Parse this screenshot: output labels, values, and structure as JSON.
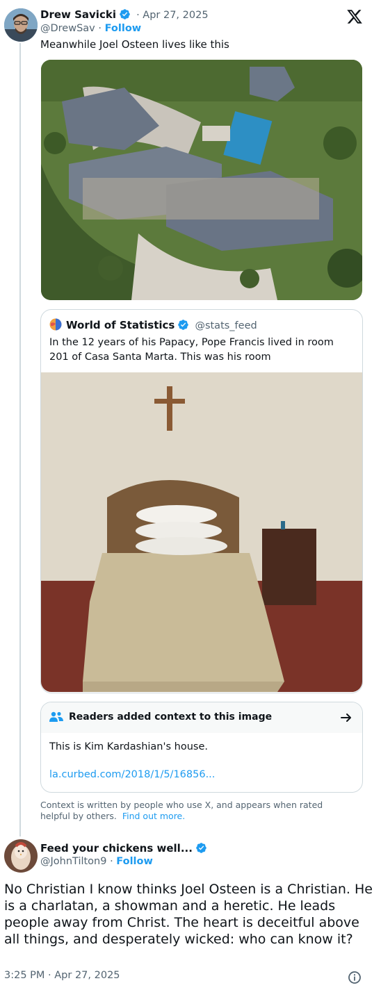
{
  "tweet": {
    "author_name": "Drew Savicki",
    "handle": "@DrewSav",
    "separator": "·",
    "date": "Apr 27, 2025",
    "follow_label": "Follow",
    "text": "Meanwhile Joel Osteen lives like this"
  },
  "quote": {
    "author_name": "World of Statistics",
    "handle": "@stats_feed",
    "text": "In the 12 years of his Papacy, Pope Francis lived in room 201 of Casa Santa Marta. This was his room"
  },
  "community_note": {
    "title": "Readers added context to this image",
    "body": "This is Kim Kardashian's house.",
    "link": "la.curbed.com/2018/1/5/16856...",
    "footer_text": "Context is written by people who use X, and appears when rated helpful by others.",
    "footer_link": "Find out more."
  },
  "reply": {
    "author_name": "Feed your chickens well...",
    "handle": "@JohnTilton9",
    "separator": "·",
    "follow_label": "Follow",
    "text": "No Christian I know thinks Joel Osteen is a Christian.  He is a charlatan, a showman and a heretic.  He leads people away from Christ. The heart is deceitful above all things, and desperately wicked: who can know it?",
    "timestamp": "3:25 PM · Apr 27, 2025"
  },
  "colors": {
    "accent": "#1d9bf0",
    "text_primary": "#0f1419",
    "text_secondary": "#536471",
    "border": "#cfd9de"
  },
  "icons": {
    "platform": "x-logo-icon",
    "verified": "verified-badge-icon",
    "note": "people-icon",
    "arrow": "arrow-right-icon",
    "info": "info-icon"
  }
}
